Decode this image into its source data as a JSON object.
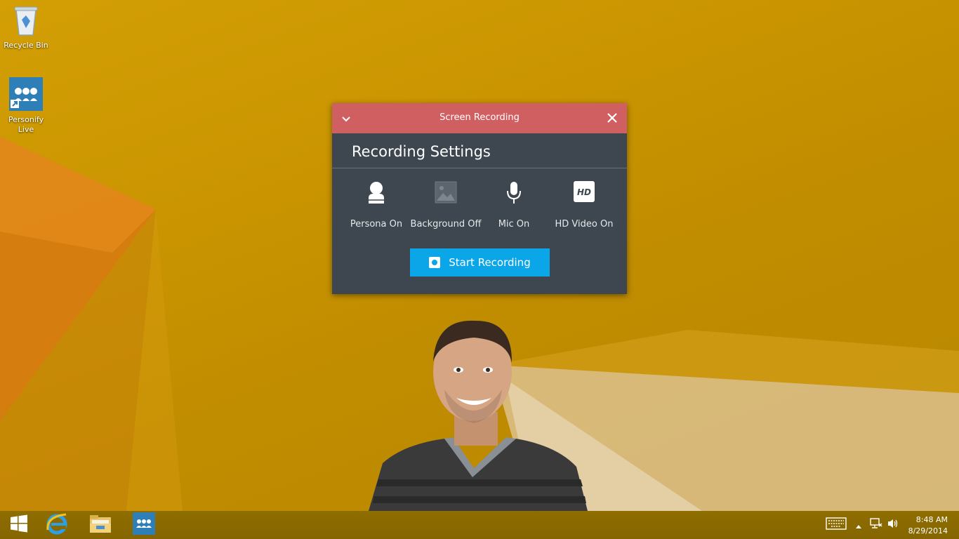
{
  "desktop": {
    "icons": [
      {
        "label": "Recycle Bin",
        "icon": "recycle-bin-icon"
      },
      {
        "label": "Personify Live",
        "icon": "personify-live-icon"
      }
    ]
  },
  "dialog": {
    "title": "Screen Recording",
    "heading": "Recording Settings",
    "options": [
      {
        "label": "Persona On",
        "icon": "persona-icon"
      },
      {
        "label": "Background Off",
        "icon": "background-image-icon"
      },
      {
        "label": "Mic On",
        "icon": "microphone-icon"
      },
      {
        "label": "HD Video On",
        "icon": "hd-video-icon",
        "badge": "HD"
      }
    ],
    "start_button": "Start Recording",
    "colors": {
      "titlebar": "#d05f62",
      "body": "#3e474f",
      "button": "#0ba6e8"
    }
  },
  "taskbar": {
    "pinned": [
      "start-icon",
      "internet-explorer-icon",
      "file-explorer-icon",
      "personify-live-icon"
    ],
    "tray": [
      "touch-keyboard-icon",
      "show-hidden-icons-icon",
      "network-icon",
      "volume-icon"
    ],
    "time": "8:48 AM",
    "date": "8/29/2014"
  }
}
